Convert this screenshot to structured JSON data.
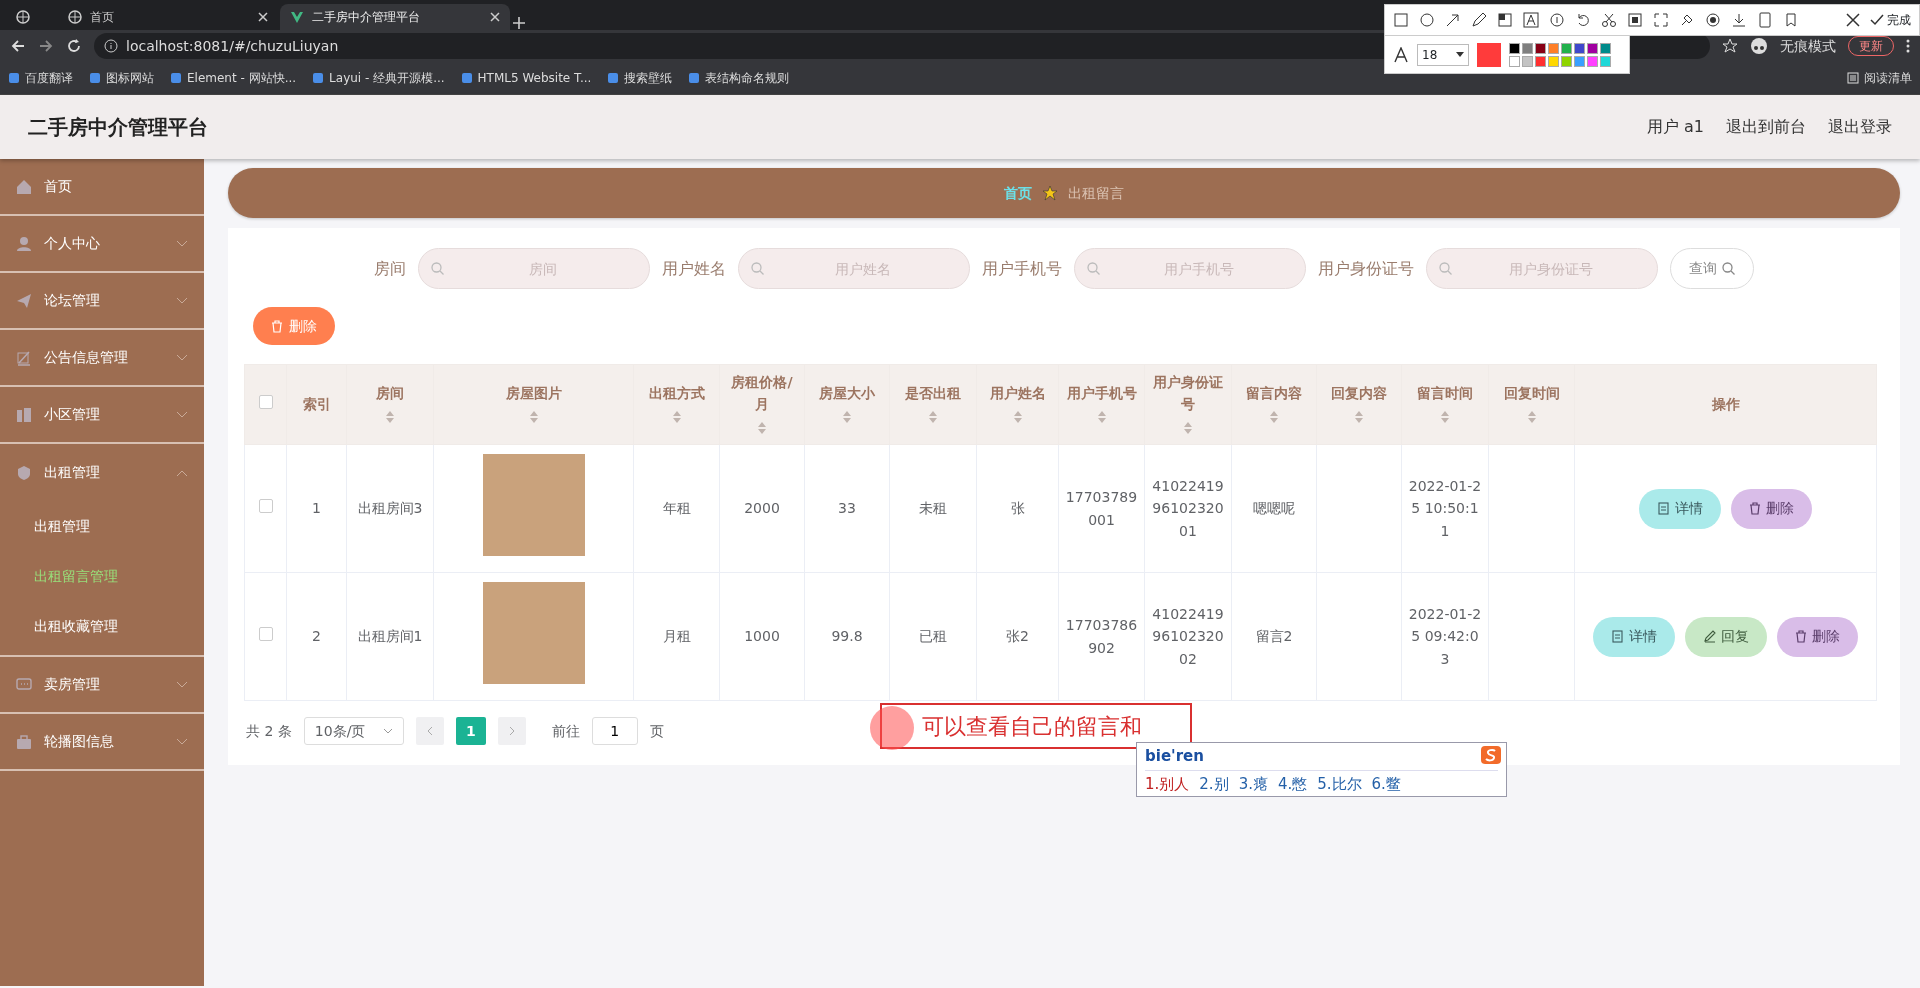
{
  "browser": {
    "tabs": [
      {
        "selected": false
      },
      {
        "title": "首页",
        "selected": false
      },
      {
        "title": "二手房中介管理平台",
        "selected": true
      }
    ],
    "url": "localhost:8081/#/chuzuLiuyan",
    "incognito": "无痕模式",
    "update": "更新",
    "bookmarks": [
      "百度翻译",
      "图标网站",
      "Element - 网站快...",
      "Layui - 经典开源模...",
      "HTML5 Website T...",
      "搜索壁纸",
      "表结构命名规则"
    ],
    "reading_list": "阅读清单"
  },
  "capture_toolbar": {
    "font_size": "18",
    "done": "完成",
    "palette": [
      {
        "color": "#000000"
      },
      {
        "color": "#7f7f7f"
      },
      {
        "color": "#880015"
      },
      {
        "color": "#ff7f27"
      },
      {
        "color": "#22b14c"
      },
      {
        "color": "#3f48cc"
      },
      {
        "color": "#a000a0"
      },
      {
        "color": "#008b8b"
      },
      {
        "color": "#ffffff"
      },
      {
        "color": "#c3c3c3"
      },
      {
        "color": "#ff3030"
      },
      {
        "color": "#ffd800"
      },
      {
        "color": "#8fd400"
      },
      {
        "color": "#3aa0ff"
      },
      {
        "color": "#ff40ff"
      },
      {
        "color": "#20d8d8"
      }
    ]
  },
  "app": {
    "title": "二手房中介管理平台",
    "user_links": [
      "用户 a1",
      "退出到前台",
      "退出登录"
    ]
  },
  "sidebar": {
    "items": [
      {
        "kind": "link",
        "label": "首页",
        "expanded": false
      },
      {
        "kind": "group",
        "label": "个人中心",
        "expanded": false
      },
      {
        "kind": "group",
        "label": "论坛管理",
        "expanded": false
      },
      {
        "kind": "group",
        "label": "公告信息管理",
        "expanded": false
      },
      {
        "kind": "group",
        "label": "小区管理",
        "expanded": false
      },
      {
        "kind": "group",
        "label": "出租管理",
        "expanded": true,
        "children": [
          {
            "label": "出租管理",
            "selected": false
          },
          {
            "label": "出租留言管理",
            "selected": true
          },
          {
            "label": "出租收藏管理",
            "selected": false
          }
        ]
      },
      {
        "kind": "group",
        "label": "卖房管理",
        "expanded": false
      },
      {
        "kind": "group",
        "label": "轮播图信息",
        "expanded": false
      }
    ]
  },
  "breadcrumb": [
    "首页",
    "出租留言"
  ],
  "search": {
    "fields": [
      {
        "label": "房间",
        "placeholder": "房间"
      },
      {
        "label": "用户姓名",
        "placeholder": "用户姓名"
      },
      {
        "label": "用户手机号",
        "placeholder": "用户手机号"
      },
      {
        "label": "用户身份证号",
        "placeholder": "用户身份证号"
      }
    ],
    "button": "查询"
  },
  "delete_button": "删除",
  "table": {
    "select_all": {
      "checked": false
    },
    "columns": [
      {
        "label": "索引",
        "sortable": false
      },
      {
        "label": "房间",
        "sortable": true
      },
      {
        "label": "房屋图片",
        "sortable": true
      },
      {
        "label": "出租方式",
        "sortable": true
      },
      {
        "label": "房租价格/月",
        "sortable": true
      },
      {
        "label": "房屋大小",
        "sortable": true
      },
      {
        "label": "是否出租",
        "sortable": true
      },
      {
        "label": "用户姓名",
        "sortable": true
      },
      {
        "label": "用户手机号",
        "sortable": true
      },
      {
        "label": "用户身份证号",
        "sortable": true
      },
      {
        "label": "留言内容",
        "sortable": true
      },
      {
        "label": "回复内容",
        "sortable": true
      },
      {
        "label": "留言时间",
        "sortable": true
      },
      {
        "label": "回复时间",
        "sortable": true
      },
      {
        "label": "操作",
        "sortable": false
      }
    ],
    "rows": [
      {
        "checked": false,
        "cells": [
          "1",
          "出租房间3",
          {
            "kind": "photo"
          },
          "年租",
          "2000",
          "33",
          "未租",
          "张",
          "17703789001",
          "410224199610232001",
          "嗯嗯呢",
          "",
          "2022-01-25 10:50:11",
          ""
        ],
        "actions": [
          {
            "kind": "detail",
            "label": "详情"
          },
          {
            "kind": "delete",
            "label": "删除"
          }
        ]
      },
      {
        "checked": false,
        "cells": [
          "2",
          "出租房间1",
          {
            "kind": "photo"
          },
          "月租",
          "1000",
          "99.8",
          "已租",
          "张2",
          "17703786902",
          "410224199610232002",
          "留言2",
          "",
          "2022-01-25 09:42:03",
          ""
        ],
        "actions": [
          {
            "kind": "detail",
            "label": "详情"
          },
          {
            "kind": "reply",
            "label": "回复"
          },
          {
            "kind": "delete",
            "label": "删除"
          }
        ]
      }
    ]
  },
  "pagination": {
    "total": "共 2 条",
    "page_size": "10条/页",
    "pages": [
      {
        "label": "1",
        "selected": true
      }
    ],
    "goto_label": "前往",
    "goto_value": "1",
    "goto_unit": "页"
  },
  "annotation": "可以查看自己的留言和",
  "ime": {
    "input": "bie'ren",
    "candidates": [
      "1.别人",
      "2.别",
      "3.瘪",
      "4.憋",
      "5.比尔",
      "6.鳖"
    ]
  }
}
